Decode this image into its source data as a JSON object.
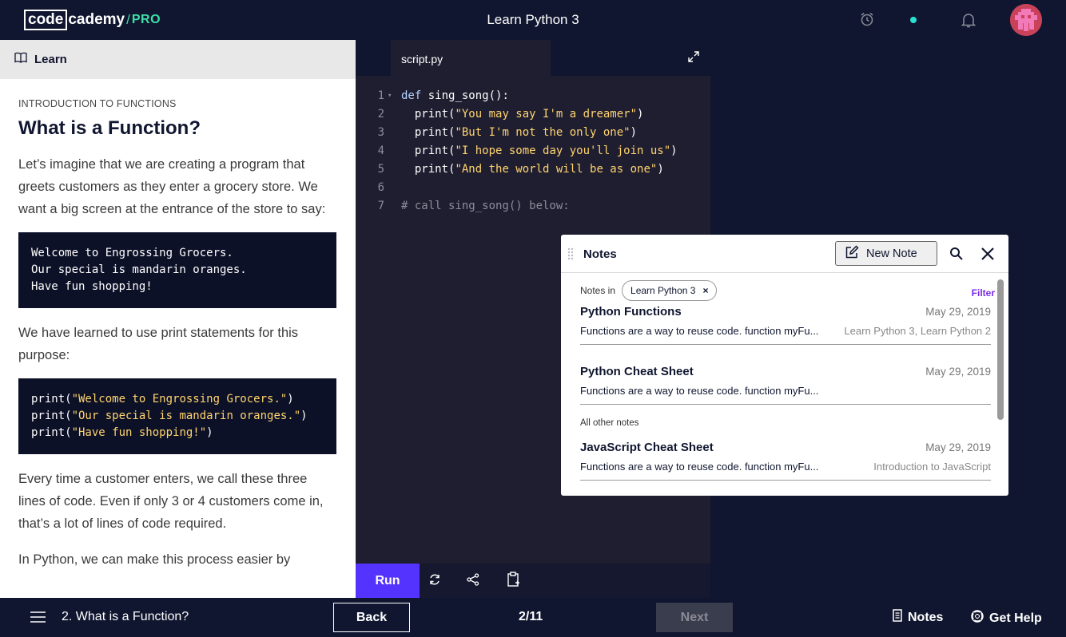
{
  "header": {
    "logo_code": "code",
    "logo_rest": "cademy",
    "logo_slash": "/",
    "logo_pro": "PRO",
    "course_title": "Learn Python 3"
  },
  "learn": {
    "tab_label": "Learn",
    "crumb": "INTRODUCTION TO FUNCTIONS",
    "title": "What is a Function?",
    "para1": "Let’s imagine that we are creating a program that greets customers as they enter a grocery store. We want a big screen at the entrance of the store to say:",
    "block1": [
      "Welcome to Engrossing Grocers.",
      "Our special is mandarin oranges.",
      "Have fun shopping!"
    ],
    "para2": "We have learned to use print statements for this purpose:",
    "block2": [
      {
        "fn": "print(",
        "str": "\"Welcome to Engrossing Grocers.\"",
        "end": ")"
      },
      {
        "fn": "print(",
        "str": "\"Our special is mandarin oranges.\"",
        "end": ")"
      },
      {
        "fn": "print(",
        "str": "\"Have fun shopping!\"",
        "end": ")"
      }
    ],
    "para3": "Every time a customer enters, we call these three lines of code. Even if only 3 or 4 customers come in, that’s a lot of lines of code required.",
    "para4": "In Python, we can make this process easier by"
  },
  "editor": {
    "file_tab": "script.py",
    "lines": [
      {
        "n": "1",
        "arrow": "▾",
        "kw": "def",
        "text": " sing_song():",
        "str": "",
        "end": ""
      },
      {
        "n": "2",
        "arrow": "",
        "kw": "",
        "text": "  print(",
        "str": "\"You may say I'm a dreamer\"",
        "end": ")"
      },
      {
        "n": "3",
        "arrow": "",
        "kw": "",
        "text": "  print(",
        "str": "\"But I'm not the only one\"",
        "end": ")"
      },
      {
        "n": "4",
        "arrow": "",
        "kw": "",
        "text": "  print(",
        "str": "\"I hope some day you'll join us\"",
        "end": ")"
      },
      {
        "n": "5",
        "arrow": "",
        "kw": "",
        "text": "  print(",
        "str": "\"And the world will be as one\"",
        "end": ")"
      },
      {
        "n": "6",
        "arrow": "",
        "kw": "",
        "text": "",
        "str": "",
        "end": ""
      },
      {
        "n": "7",
        "arrow": "",
        "kw": "",
        "text": "",
        "str": "",
        "end": "",
        "comment": "# call sing_song() below:"
      }
    ],
    "run_label": "Run"
  },
  "notes_panel": {
    "title": "Notes",
    "new_note_label": "New Note",
    "notes_in_label": "Notes in",
    "chip_label": "Learn Python 3",
    "chip_close": "×",
    "filter_label": "Filter",
    "notes": [
      {
        "title": "Python Functions",
        "date": "May 29, 2019",
        "excerpt": "Functions are a way to reuse code. function myFu...",
        "tags": "Learn Python 3, Learn Python 2"
      },
      {
        "title": "Python Cheat Sheet",
        "date": "May 29, 2019",
        "excerpt": "Functions are a way to reuse code. function myFu...",
        "tags": ""
      }
    ],
    "other_label": "All other notes",
    "other_notes": [
      {
        "title": "JavaScript Cheat Sheet",
        "date": "May 29, 2019",
        "excerpt": "Functions are a way to reuse code. function myFu...",
        "tags": "Introduction to JavaScript"
      }
    ]
  },
  "footer": {
    "lesson_name": "2. What is a Function?",
    "back_label": "Back",
    "page_count": "2/11",
    "next_label": "Next",
    "notes_label": "Notes",
    "help_label": "Get Help"
  },
  "colors": {
    "brand_dark": "#10162f",
    "accent_run": "#5533ff",
    "pro_green": "#3ee0a8",
    "code_string": "#ffd46e",
    "filter_purple": "#7a2be8"
  }
}
